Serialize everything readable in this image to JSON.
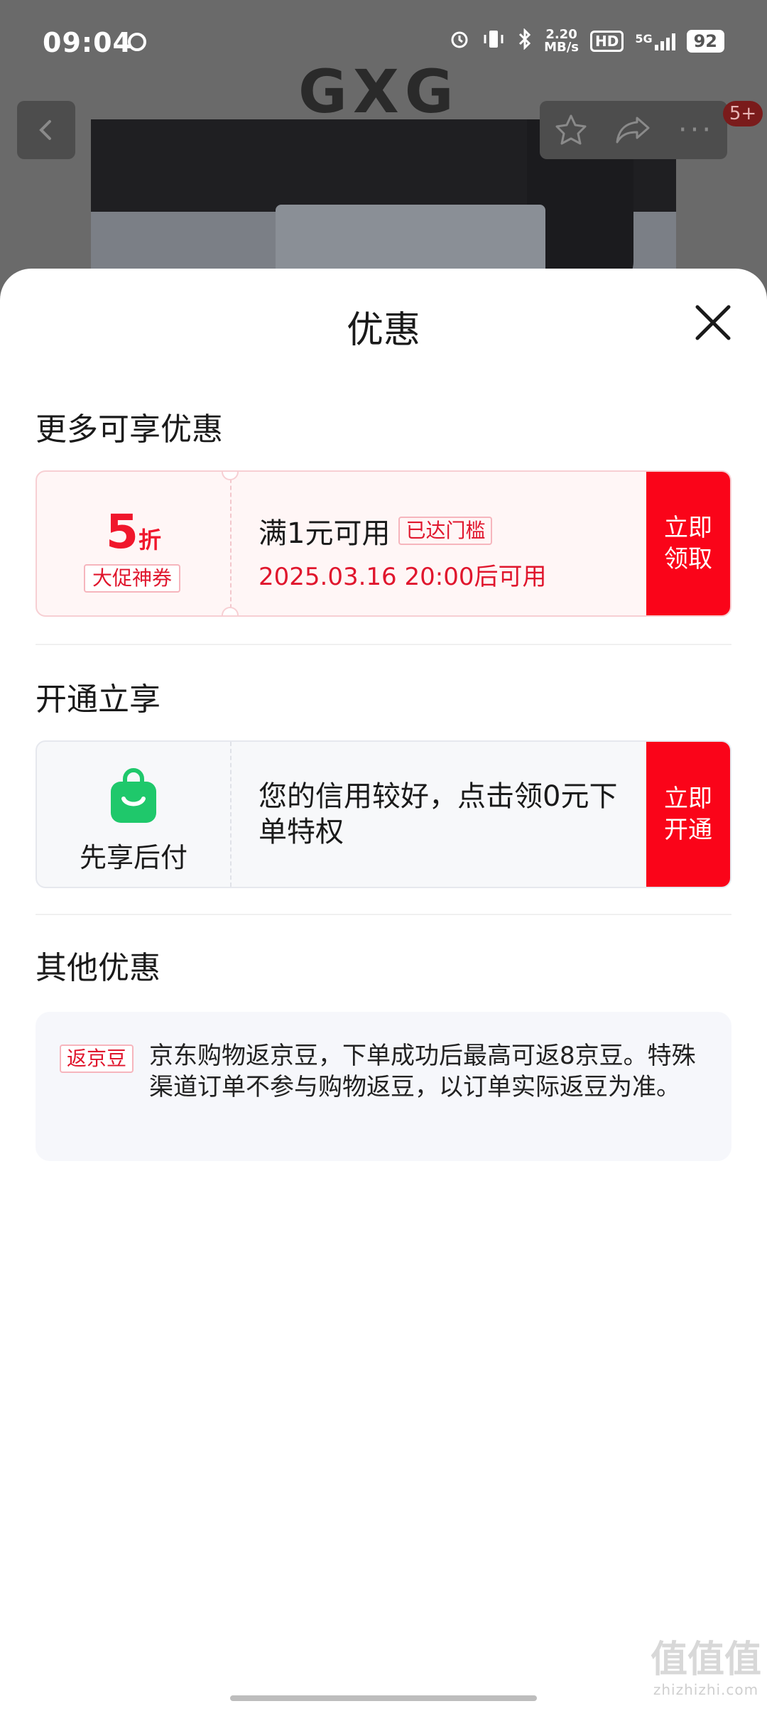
{
  "status_bar": {
    "time": "09:04",
    "network_speed_value": "2.20",
    "network_speed_unit": "MB/s",
    "hd": "HD",
    "network": "5G",
    "battery": "92"
  },
  "product_page": {
    "brand": "GXG",
    "cart_badge": "5+"
  },
  "sheet": {
    "title": "优惠",
    "section_more": "更多可享优惠",
    "coupon": {
      "value": "5",
      "unit": "折",
      "tag": "大促神券",
      "condition": "满1元可用",
      "threshold_tag": "已达门槛",
      "valid_time": "2025.03.16 20:00后可用",
      "claim_label_line1": "立即",
      "claim_label_line2": "领取"
    },
    "section_open": "开通立享",
    "credit": {
      "label": "先享后付",
      "text": "您的信用较好，点击领0元下单特权",
      "open_label_line1": "立即",
      "open_label_line2": "开通"
    },
    "section_other": "其他优惠",
    "other": {
      "tag": "返京豆",
      "text": "京东购物返京豆，下单成功后最高可返8京豆。特殊渠道订单不参与购物返豆，以订单实际返豆为准。"
    }
  },
  "watermark": {
    "glyphs": "值值值",
    "site": "zhizhizhi.com"
  },
  "colors": {
    "accent_red": "#fa0419",
    "coupon_bg": "#fff6f6",
    "green": "#1fc86b"
  }
}
